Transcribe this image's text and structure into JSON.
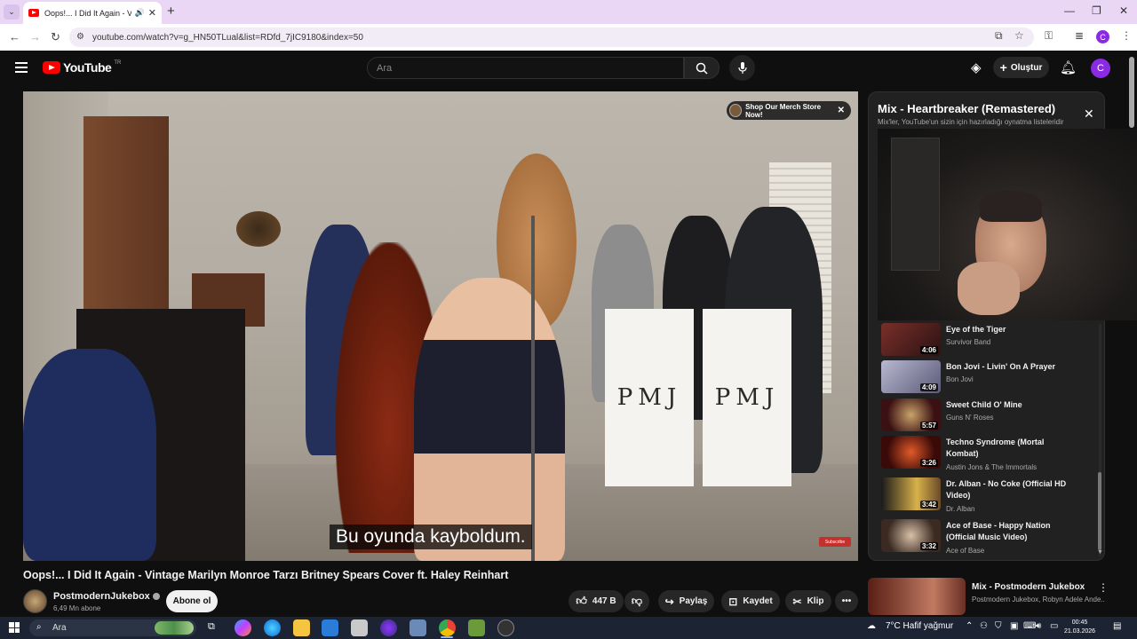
{
  "browser": {
    "tab_title": "Oops!... I Did It Again - Vint",
    "url": "youtube.com/watch?v=g_HN50TLual&list=RDfd_7jIC9180&index=50"
  },
  "youtube": {
    "logo_word": "YouTube",
    "country_code": "TR",
    "search_placeholder": "Ara",
    "create_label": "Oluştur",
    "avatar_letter": "C"
  },
  "player": {
    "merch_label": "Shop Our Merch Store Now!",
    "subtitle": "Bu oyunda kayboldum.",
    "watermark": "Subscribe",
    "pmj_text": "PMJ"
  },
  "video": {
    "title": "Oops!... I Did It Again - Vintage Marilyn Monroe Tarzı Britney Spears Cover ft. Haley Reinhart",
    "channel": "PostmodernJukebox",
    "subscribers": "6,49 Mn abone",
    "subscribe_label": "Abone ol",
    "likes": "447 B",
    "share_label": "Paylaş",
    "save_label": "Kaydet",
    "clip_label": "Klip"
  },
  "playlist": {
    "title": "Mix - Heartbreaker (Remastered)",
    "subtitle": "Mix'ler, YouTube'un sizin için hazırladığı oynatma listeleridir",
    "items": [
      {
        "title": "Eye of the Tiger",
        "artist": "Survivor Band",
        "duration": "4:06",
        "color": "#7a2f2a"
      },
      {
        "title": "Bon Jovi - Livin' On A Prayer",
        "artist": "Bon Jovi",
        "duration": "4:09",
        "color": "#8a8aa8"
      },
      {
        "title": "Sweet Child O' Mine",
        "artist": "Guns N' Roses",
        "duration": "5:57",
        "color": "#3a1012"
      },
      {
        "title": "Techno Syndrome (Mortal Kombat)",
        "artist": "Austin Jons & The Immortals",
        "duration": "3:26",
        "color": "#c4331e"
      },
      {
        "title": "Dr. Alban - No Coke (Official HD Video)",
        "artist": "Dr. Alban",
        "duration": "3:42",
        "color": "#d8b14a"
      },
      {
        "title": "Ace of Base - Happy Nation (Official Music Video)",
        "artist": "Ace of Base",
        "duration": "3:32",
        "color": "#9a7a6a"
      }
    ]
  },
  "recommendation": {
    "title": "Mix - Postmodern Jukebox",
    "subtitle": "Postmodern Jukebox, Robyn Adele Ande..."
  },
  "taskbar": {
    "search_label": "Ara",
    "weather": "7°C  Hafif yağmur",
    "time": "00:45",
    "date": "21.03.2026"
  }
}
